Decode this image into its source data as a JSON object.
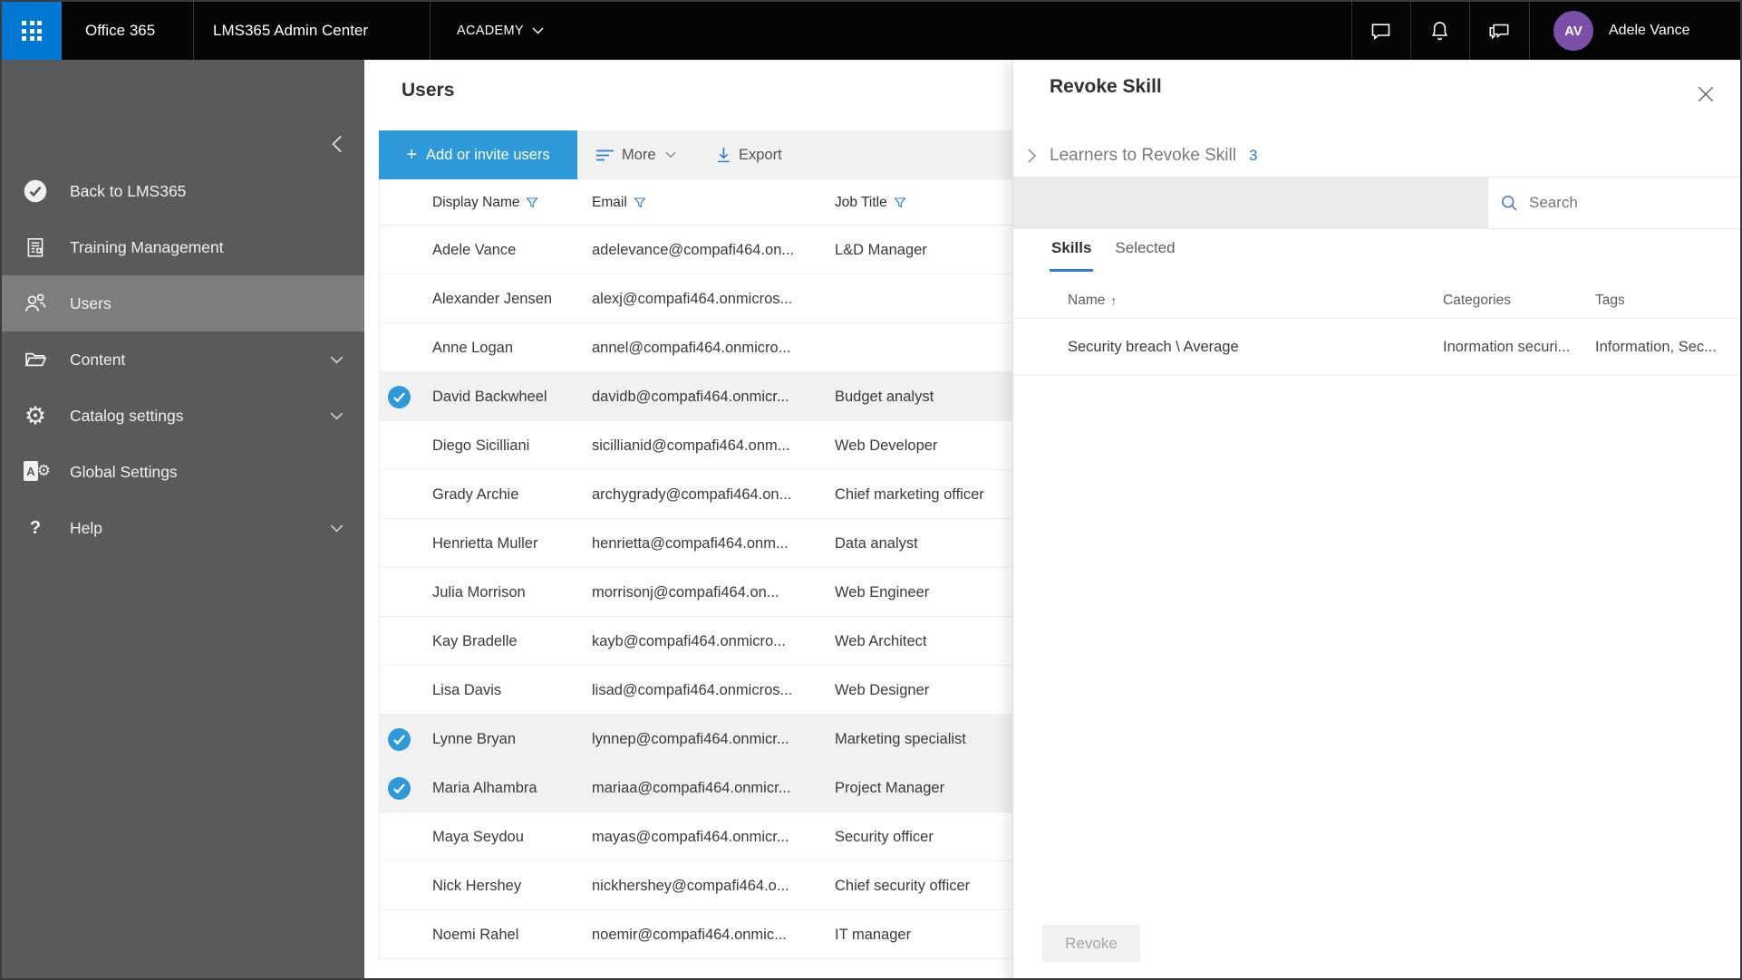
{
  "colors": {
    "ms_blue": "#0078d4",
    "accent": "#2b7cd6",
    "accent_button": "#2f9ada",
    "avatar_purple": "#7b4fa8",
    "topbar_bg": "#050505",
    "sidebar_bg": "#595a5b",
    "sidebar_selected": "#7b7d7e"
  },
  "topbar": {
    "office_label": "Office 365",
    "admin_center_label": "LMS365 Admin Center",
    "academy_label": "ACADEMY",
    "user_initials": "AV",
    "user_name": "Adele Vance",
    "icons": [
      "chat-icon",
      "bell-icon",
      "feedback-icon"
    ]
  },
  "sidebar": {
    "items": [
      {
        "label": "Back to LMS365",
        "icon": "check-circle-icon",
        "selected": false,
        "chevron": false
      },
      {
        "label": "Training Management",
        "icon": "document-icon",
        "selected": false,
        "chevron": false
      },
      {
        "label": "Users",
        "icon": "users-icon",
        "selected": true,
        "chevron": false
      },
      {
        "label": "Content",
        "icon": "folder-icon",
        "selected": false,
        "chevron": true
      },
      {
        "label": "Catalog settings",
        "icon": "gear-icon",
        "selected": false,
        "chevron": true
      },
      {
        "label": "Global Settings",
        "icon": "admin-icon",
        "selected": false,
        "chevron": false
      },
      {
        "label": "Help",
        "icon": "help-icon",
        "selected": false,
        "chevron": true
      }
    ]
  },
  "main": {
    "title": "Users",
    "toolbar": {
      "add_label": "Add or invite users",
      "add_plus": "+",
      "more_label": "More",
      "export_label": "Export"
    },
    "table": {
      "columns": [
        {
          "label": "Display Name"
        },
        {
          "label": "Email"
        },
        {
          "label": "Job Title"
        }
      ],
      "rows": [
        {
          "name": "Adele Vance",
          "email": "adelevance@compafi464.on...",
          "job": "L&D Manager",
          "selected": false
        },
        {
          "name": "Alexander Jensen",
          "email": "alexj@compafi464.onmicros...",
          "job": "",
          "selected": false
        },
        {
          "name": "Anne Logan",
          "email": "annel@compafi464.onmicro...",
          "job": "",
          "selected": false
        },
        {
          "name": "David Backwheel",
          "email": "davidb@compafi464.onmicr...",
          "job": "Budget analyst",
          "selected": true
        },
        {
          "name": "Diego Sicilliani",
          "email": "sicillianid@compafi464.onm...",
          "job": "Web Developer",
          "selected": false
        },
        {
          "name": "Grady Archie",
          "email": "archygrady@compafi464.on...",
          "job": "Chief marketing officer",
          "selected": false
        },
        {
          "name": "Henrietta Muller",
          "email": "henrietta@compafi464.onm...",
          "job": "Data analyst",
          "selected": false
        },
        {
          "name": "Julia Morrison",
          "email": "morrisonj@compafi464.on...",
          "job": "Web Engineer",
          "selected": false
        },
        {
          "name": "Kay Bradelle",
          "email": "kayb@compafi464.onmicro...",
          "job": "Web Architect",
          "selected": false
        },
        {
          "name": "Lisa Davis",
          "email": "lisad@compafi464.onmicros...",
          "job": "Web Designer",
          "selected": false
        },
        {
          "name": "Lynne Bryan",
          "email": "lynnep@compafi464.onmicr...",
          "job": "Marketing specialist",
          "selected": true
        },
        {
          "name": "Maria Alhambra",
          "email": "mariaa@compafi464.onmicr...",
          "job": "Project Manager",
          "selected": true
        },
        {
          "name": "Maya Seydou",
          "email": "mayas@compafi464.onmicr...",
          "job": "Security officer",
          "selected": false
        },
        {
          "name": "Nick Hershey",
          "email": "nickhershey@compafi464.o...",
          "job": "Chief security officer",
          "selected": false
        },
        {
          "name": "Noemi Rahel",
          "email": "noemir@compafi464.onmic...",
          "job": "IT manager",
          "selected": false
        }
      ]
    }
  },
  "panel": {
    "title": "Revoke Skill",
    "learners_label": "Learners to Revoke Skill",
    "learners_count": "3",
    "search_placeholder": "Search",
    "tabs": [
      {
        "label": "Skills",
        "active": true
      },
      {
        "label": "Selected",
        "active": false
      }
    ],
    "table": {
      "columns": [
        {
          "label": "Name"
        },
        {
          "label": "Categories"
        },
        {
          "label": "Tags"
        }
      ],
      "sort_arrow": "↑",
      "rows": [
        {
          "name": "Security breach \\ Average",
          "categories": "Inormation securi...",
          "tags": "Information, Sec..."
        }
      ]
    },
    "revoke_label": "Revoke"
  }
}
